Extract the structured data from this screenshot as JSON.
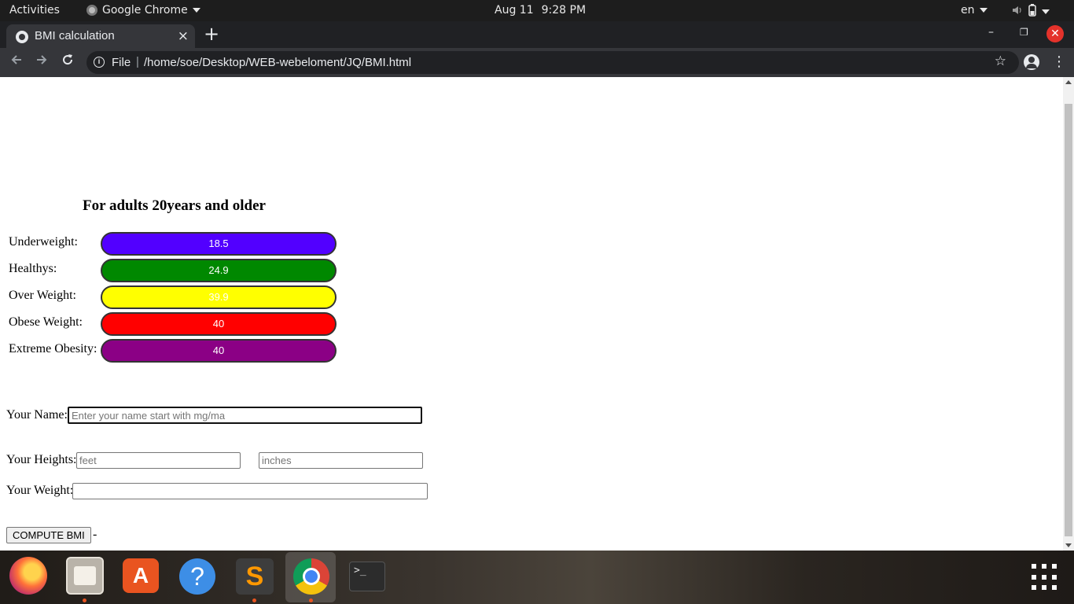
{
  "topbar": {
    "activities": "Activities",
    "app_name": "Google Chrome",
    "date": "Aug 11",
    "time": "9:28 PM",
    "language": "en",
    "icons": [
      "volume-icon",
      "battery-icon",
      "power-menu-icon"
    ]
  },
  "browser": {
    "tab_title": "BMI calculation",
    "tab_close": "×",
    "new_tab": "+",
    "window_min": "–",
    "window_max": "❐",
    "window_close": "✕",
    "scheme_label": "File",
    "separator": "|",
    "url": "/home/soe/Desktop/WEB-webeloment/JQ/BMI.html"
  },
  "page": {
    "heading": "For adults 20years and older",
    "bmi_categories": [
      {
        "label": "Underweight:",
        "value": "18.5",
        "color": "#5200ff"
      },
      {
        "label": "Healthys:",
        "value": "24.9",
        "color": "#008800"
      },
      {
        "label": "Over Weight:",
        "value": "39.9",
        "color": "#ffff00"
      },
      {
        "label": "Obese Weight:",
        "value": "40",
        "color": "#ff0000"
      },
      {
        "label": "Extreme Obesity:",
        "value": "40",
        "color": "#8b0085"
      }
    ],
    "form": {
      "name_label": "Your Name:",
      "name_placeholder": "Enter your name start with mg/ma",
      "name_value": "",
      "heights_label": "Your Heights:",
      "feet_placeholder": "feet",
      "inches_placeholder": "inches",
      "weight_label": "Your Weight:",
      "weight_value": "",
      "compute_button": "COMPUTE BMI",
      "result": "-"
    }
  },
  "dock": {
    "apps": [
      "firefox-icon",
      "files-icon",
      "software-center-icon",
      "help-icon",
      "sublime-text-icon",
      "chrome-icon",
      "terminal-icon"
    ],
    "terminal_glyph": ">_",
    "help_glyph": "?",
    "store_glyph": "A",
    "sublime_glyph": "S"
  }
}
